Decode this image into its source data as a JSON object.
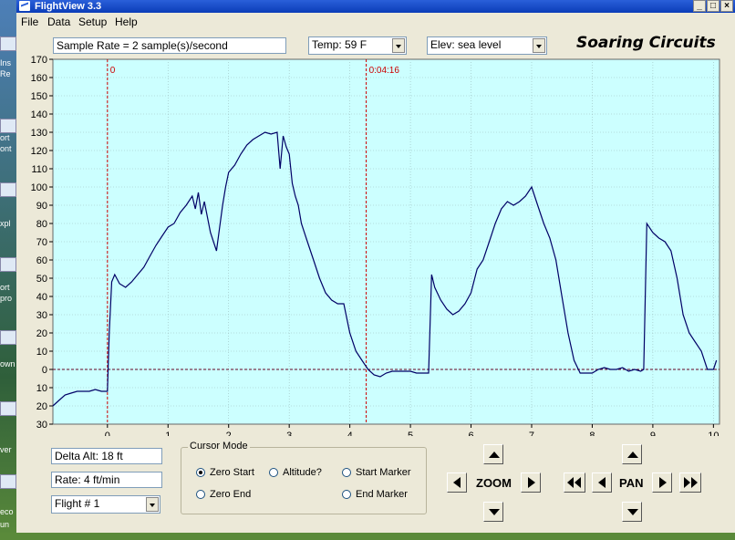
{
  "window": {
    "title": "FlightView 3.3",
    "titlebar_buttons": [
      "_",
      "□",
      "×"
    ]
  },
  "menu": [
    "File",
    "Data",
    "Setup",
    "Help"
  ],
  "header": {
    "sample_rate": "Sample Rate =  2 sample(s)/second",
    "temp_selected": "Temp:  59 F",
    "elev_selected": "Elev: sea level",
    "brand": "Soaring Circuits"
  },
  "desktop": {
    "icon_labels": [
      "Ins",
      "Re",
      "ort",
      "ont",
      "xpl",
      "ort",
      "pro",
      "own",
      "ver",
      "eco",
      "un"
    ]
  },
  "chart_data": {
    "type": "line",
    "title": "",
    "xlabel": "",
    "ylabel": "",
    "xlim": [
      -0.9,
      10.1
    ],
    "ylim": [
      -30,
      170
    ],
    "x_ticks": [
      0,
      1,
      2,
      3,
      4,
      5,
      6,
      7,
      8,
      9,
      10
    ],
    "y_ticks": [
      170,
      160,
      150,
      140,
      130,
      120,
      110,
      100,
      90,
      80,
      70,
      60,
      50,
      40,
      30,
      20,
      10,
      0,
      10,
      20,
      30
    ],
    "background": "#ccffff",
    "line_color": "#000066",
    "grid": true,
    "markers": [
      {
        "x": 0,
        "label": "0"
      },
      {
        "x": 4.27,
        "label": "0:04:16"
      }
    ],
    "series": [
      {
        "x": [
          -0.9,
          -0.8,
          -0.7,
          -0.6,
          -0.5,
          -0.4,
          -0.3,
          -0.2,
          -0.1,
          0.0,
          0.03,
          0.07,
          0.12,
          0.2,
          0.3,
          0.4,
          0.5,
          0.6,
          0.7,
          0.8,
          0.9,
          1.0,
          1.1,
          1.2,
          1.3,
          1.4,
          1.45,
          1.5,
          1.55,
          1.6,
          1.7,
          1.8,
          1.9,
          1.95,
          2.0,
          2.1,
          2.2,
          2.3,
          2.4,
          2.5,
          2.6,
          2.7,
          2.8,
          2.85,
          2.9,
          2.95,
          3.0,
          3.05,
          3.1,
          3.15,
          3.2,
          3.3,
          3.4,
          3.5,
          3.6,
          3.7,
          3.8,
          3.9,
          4.0,
          4.1,
          4.2,
          4.3,
          4.4,
          4.5,
          4.6,
          4.7,
          4.8,
          4.9,
          5.0,
          5.1,
          5.2,
          5.3,
          5.35,
          5.4,
          5.5,
          5.6,
          5.7,
          5.8,
          5.9,
          6.0,
          6.1,
          6.2,
          6.3,
          6.4,
          6.5,
          6.6,
          6.7,
          6.8,
          6.9,
          7.0,
          7.1,
          7.2,
          7.3,
          7.4,
          7.5,
          7.6,
          7.7,
          7.8,
          7.9,
          8.0,
          8.1,
          8.2,
          8.3,
          8.4,
          8.5,
          8.6,
          8.7,
          8.8,
          8.85,
          8.9,
          9.0,
          9.1,
          9.2,
          9.3,
          9.4,
          9.5,
          9.6,
          9.7,
          9.8,
          9.9,
          10.0,
          10.05
        ],
        "values": [
          -20,
          -17,
          -14,
          -13,
          -12,
          -12,
          -12,
          -11,
          -12,
          -12,
          20,
          48,
          52,
          47,
          45,
          48,
          52,
          56,
          62,
          68,
          73,
          78,
          80,
          86,
          90,
          95,
          88,
          97,
          85,
          92,
          75,
          65,
          90,
          100,
          108,
          112,
          118,
          123,
          126,
          128,
          130,
          129,
          130,
          110,
          128,
          122,
          118,
          102,
          95,
          90,
          80,
          70,
          60,
          50,
          42,
          38,
          36,
          36,
          20,
          10,
          5,
          0,
          -3,
          -4,
          -2,
          -1,
          -1,
          -1,
          -1,
          -2,
          -2,
          -2,
          52,
          45,
          38,
          33,
          30,
          32,
          36,
          42,
          55,
          60,
          70,
          80,
          88,
          92,
          90,
          92,
          95,
          100,
          90,
          80,
          72,
          60,
          40,
          20,
          5,
          -2,
          -2,
          -2,
          0,
          1,
          0,
          0,
          1,
          -1,
          0,
          -1,
          0,
          80,
          75,
          72,
          70,
          65,
          50,
          30,
          20,
          15,
          10,
          0,
          0,
          5
        ]
      }
    ]
  },
  "readouts": {
    "delta_alt": "Delta Alt: 18 ft",
    "rate": "Rate: 4 ft/min",
    "flight_selected": "Flight # 1"
  },
  "cursor_mode": {
    "legend": "Cursor Mode",
    "options": [
      {
        "label": "Zero Start",
        "checked": true
      },
      {
        "label": "Altitude?",
        "checked": false
      },
      {
        "label": "Start Marker",
        "checked": false
      },
      {
        "label": "Zero End",
        "checked": false
      },
      {
        "label": "End Marker",
        "checked": false
      }
    ]
  },
  "zoom": {
    "label": "ZOOM"
  },
  "pan": {
    "label": "PAN"
  }
}
